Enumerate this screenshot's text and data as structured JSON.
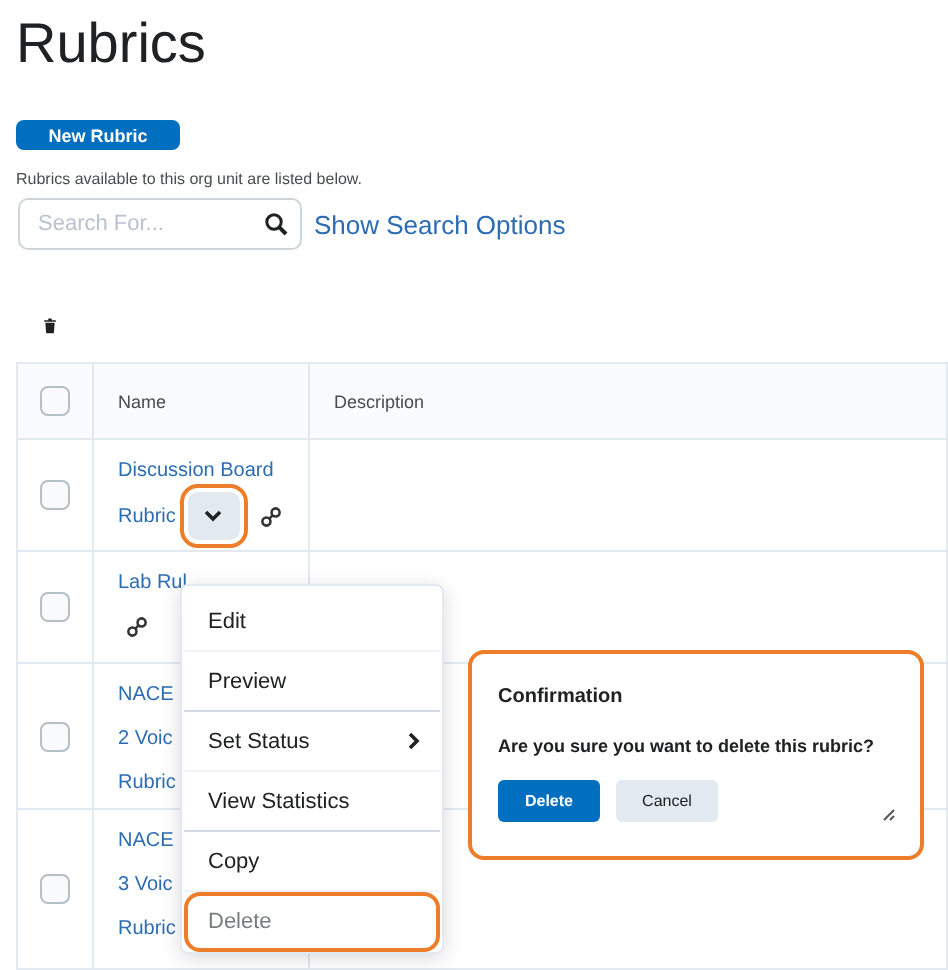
{
  "page": {
    "title": "Rubrics"
  },
  "new_button": "New Rubric",
  "helper_text": "Rubrics available to this org unit are listed below.",
  "search": {
    "placeholder": "Search For..."
  },
  "search_options_link": "Show Search Options",
  "table": {
    "columns": [
      {
        "label": "Name"
      },
      {
        "label": "Description"
      }
    ],
    "header_checked": false,
    "rows": [
      {
        "lines": [
          "Discussion Board",
          "Rubric"
        ],
        "checked": false,
        "menu_button": {
          "highlighted": true
        },
        "link_icon": true,
        "link_icon_below": false
      },
      {
        "lines": [
          "Lab Rul"
        ],
        "checked": false,
        "link_icon": true,
        "link_icon_below": true
      },
      {
        "lines": [
          "NACE",
          "2 Voic",
          "Rubric"
        ],
        "checked": false,
        "link_icon": false
      },
      {
        "lines": [
          "NACE",
          "3 Voic",
          "Rubric"
        ],
        "checked": false,
        "link_icon": false
      }
    ]
  },
  "context_menu": {
    "items": [
      {
        "label": "Edit",
        "submenu": false,
        "group_end": false,
        "highlighted": false
      },
      {
        "label": "Preview",
        "submenu": false,
        "group_end": true,
        "highlighted": false
      },
      {
        "label": "Set Status",
        "submenu": true,
        "group_end": false,
        "highlighted": false
      },
      {
        "label": "View Statistics",
        "submenu": false,
        "group_end": true,
        "highlighted": false
      },
      {
        "label": "Copy",
        "submenu": false,
        "group_end": false,
        "highlighted": false
      },
      {
        "label": "Delete",
        "submenu": false,
        "group_end": false,
        "highlighted": true
      }
    ]
  },
  "dialog": {
    "title": "Confirmation",
    "message": "Are you sure you want to delete this rubric?",
    "highlighted": true,
    "buttons": [
      {
        "label": "Delete",
        "kind": "primary"
      },
      {
        "label": "Cancel",
        "kind": "secondary"
      }
    ]
  }
}
